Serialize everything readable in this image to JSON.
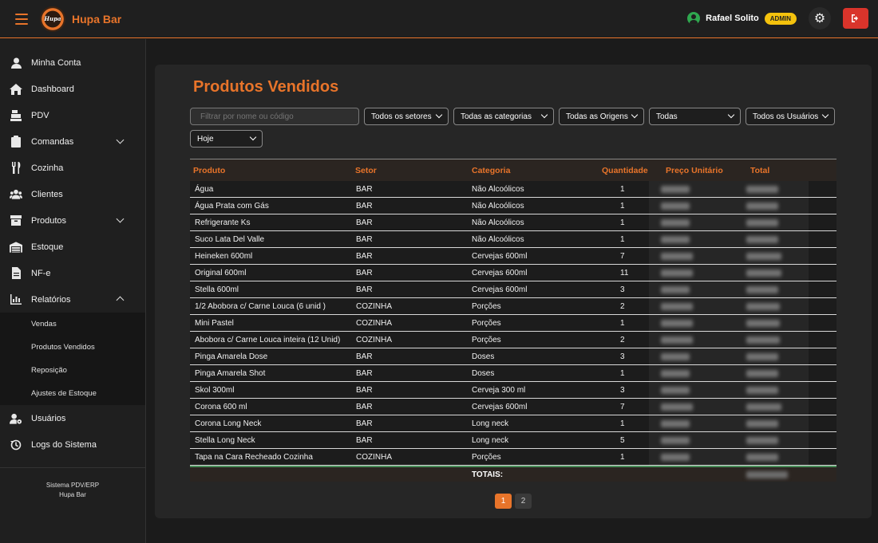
{
  "header": {
    "brand": "Hupa Bar",
    "logo_text": "Hupa",
    "user_name": "Rafael Solito",
    "role_badge": "ADMIN"
  },
  "sidebar": {
    "items": [
      {
        "label": "Minha Conta",
        "icon": "user-icon"
      },
      {
        "label": "Dashboard",
        "icon": "home-icon"
      },
      {
        "label": "PDV",
        "icon": "cash-register-icon"
      },
      {
        "label": "Comandas",
        "icon": "clipboard-icon",
        "expandable": true
      },
      {
        "label": "Cozinha",
        "icon": "utensils-icon"
      },
      {
        "label": "Clientes",
        "icon": "users-icon"
      },
      {
        "label": "Produtos",
        "icon": "box-icon",
        "expandable": true
      },
      {
        "label": "Estoque",
        "icon": "warehouse-icon"
      },
      {
        "label": "NF-e",
        "icon": "file-icon"
      },
      {
        "label": "Relatórios",
        "icon": "chart-icon",
        "expanded": true
      }
    ],
    "reports_submenu": [
      "Vendas",
      "Produtos Vendidos",
      "Reposição",
      "Ajustes de Estoque"
    ],
    "bottom_items": [
      {
        "label": "Usuários",
        "icon": "user-gear-icon"
      },
      {
        "label": "Logs do Sistema",
        "icon": "history-icon"
      }
    ],
    "footer_line1": "Sistema PDV/ERP",
    "footer_line2": "Hupa Bar"
  },
  "main": {
    "title": "Produtos Vendidos",
    "filters": {
      "search_placeholder": "Filtrar por nome ou código",
      "setores": "Todos os setores",
      "categorias": "Todas as categorias",
      "origens": "Todas as Origens",
      "status": "Todas",
      "usuarios": "Todos os Usuários",
      "periodo": "Hoje"
    },
    "columns": [
      "Produto",
      "Setor",
      "Categoria",
      "Quantidade",
      "Preço Unitário",
      "Total"
    ],
    "rows": [
      {
        "produto": "Água",
        "setor": "BAR",
        "categoria": "Não Alcoólicos",
        "quantidade": "1"
      },
      {
        "produto": "Água Prata com Gás",
        "setor": "BAR",
        "categoria": "Não Alcoólicos",
        "quantidade": "1"
      },
      {
        "produto": "Refrigerante Ks",
        "setor": "BAR",
        "categoria": "Não Alcoólicos",
        "quantidade": "1"
      },
      {
        "produto": "Suco Lata Del Valle",
        "setor": "BAR",
        "categoria": "Não Alcoólicos",
        "quantidade": "1"
      },
      {
        "produto": "Heineken 600ml",
        "setor": "BAR",
        "categoria": "Cervejas 600ml",
        "quantidade": "7"
      },
      {
        "produto": "Original 600ml",
        "setor": "BAR",
        "categoria": "Cervejas 600ml",
        "quantidade": "11"
      },
      {
        "produto": "Stella 600ml",
        "setor": "BAR",
        "categoria": "Cervejas 600ml",
        "quantidade": "3"
      },
      {
        "produto": "1/2 Abobora c/ Carne Louca (6 unid )",
        "setor": "COZINHA",
        "categoria": "Porções",
        "quantidade": "2"
      },
      {
        "produto": "Mini Pastel",
        "setor": "COZINHA",
        "categoria": "Porções",
        "quantidade": "1"
      },
      {
        "produto": "Abobora c/ Carne Louca inteira (12 Unid)",
        "setor": "COZINHA",
        "categoria": "Porções",
        "quantidade": "2"
      },
      {
        "produto": "Pinga Amarela Dose",
        "setor": "BAR",
        "categoria": "Doses",
        "quantidade": "3"
      },
      {
        "produto": "Pinga Amarela Shot",
        "setor": "BAR",
        "categoria": "Doses",
        "quantidade": "1"
      },
      {
        "produto": "Skol 300ml",
        "setor": "BAR",
        "categoria": "Cerveja 300 ml",
        "quantidade": "3"
      },
      {
        "produto": "Corona 600 ml",
        "setor": "BAR",
        "categoria": "Cervejas 600ml",
        "quantidade": "7"
      },
      {
        "produto": "Corona Long Neck",
        "setor": "BAR",
        "categoria": "Long neck",
        "quantidade": "1"
      },
      {
        "produto": "Stella Long Neck",
        "setor": "BAR",
        "categoria": "Long neck",
        "quantidade": "5"
      },
      {
        "produto": "Tapa na Cara Recheado Cozinha",
        "setor": "COZINHA",
        "categoria": "Porções",
        "quantidade": "1"
      }
    ],
    "totals_label": "TOTAIS:",
    "pages": [
      "1",
      "2"
    ],
    "active_page": "1"
  },
  "colors": {
    "accent": "#e8742a",
    "logout": "#d9342b",
    "badge": "#f4c20d",
    "online": "#2fa84f"
  }
}
